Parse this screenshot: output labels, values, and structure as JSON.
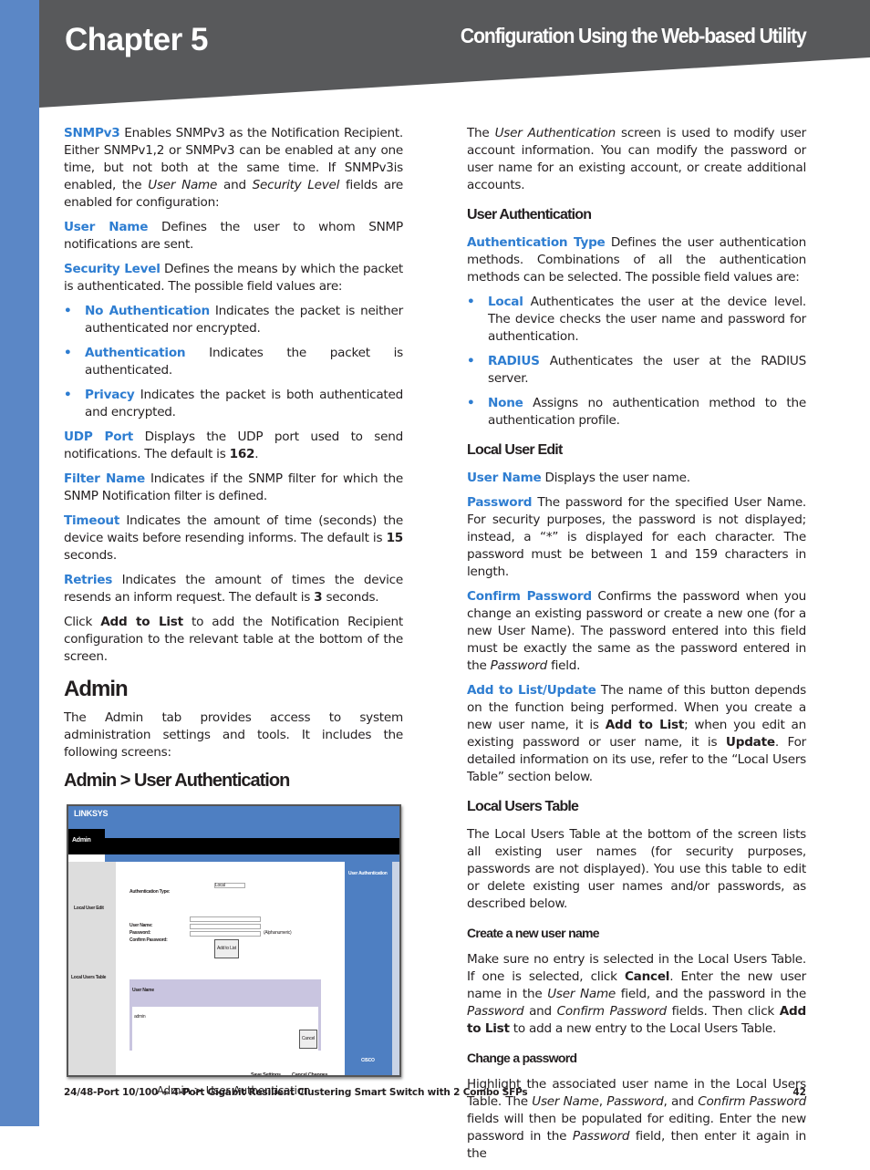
{
  "header": {
    "chapter": "Chapter 5",
    "title": "Configuration Using the Web-based Utility"
  },
  "colors": {
    "accent": "#2e7dd1",
    "band": "#58595b",
    "strip": "#5b87c6"
  },
  "left": [
    {
      "type": "p",
      "segs": [
        [
          "t",
          "SNMPv3"
        ],
        [
          "n",
          "  Enables SNMPv3 as the Notification Recipient. Either SNMPv1,2 or SNMPv3 can be enabled at any one time, but not both at the same time. If SNMPv3is enabled, the "
        ],
        [
          "i",
          "User Name"
        ],
        [
          "n",
          " and "
        ],
        [
          "i",
          "Security Level"
        ],
        [
          "n",
          " fields are enabled for configuration:"
        ]
      ]
    },
    {
      "type": "p",
      "segs": [
        [
          "t",
          "User Name"
        ],
        [
          "n",
          "  Defines the user to whom SNMP notifications are sent."
        ]
      ]
    },
    {
      "type": "p",
      "segs": [
        [
          "t",
          "Security Level"
        ],
        [
          "n",
          "  Defines the means by which the packet is authenticated. The possible field values are:"
        ]
      ]
    },
    {
      "type": "bullet",
      "segs": [
        [
          "t",
          "No Authentication"
        ],
        [
          "n",
          "  Indicates the packet is neither authenticated nor encrypted."
        ]
      ]
    },
    {
      "type": "bullet",
      "segs": [
        [
          "t",
          "Authentication"
        ],
        [
          "n",
          "  Indicates the packet is authenticated."
        ]
      ]
    },
    {
      "type": "bullet",
      "segs": [
        [
          "t",
          "Privacy"
        ],
        [
          "n",
          "  Indicates the packet is both authenticated and encrypted."
        ]
      ]
    },
    {
      "type": "p",
      "segs": [
        [
          "t",
          "UDP Port"
        ],
        [
          "n",
          "  Displays the UDP port used to send notifications. The default is "
        ],
        [
          "b",
          "162"
        ],
        [
          "n",
          "."
        ]
      ]
    },
    {
      "type": "p",
      "segs": [
        [
          "t",
          "Filter Name"
        ],
        [
          "n",
          "  Indicates if the SNMP filter for which the SNMP Notification filter is defined."
        ]
      ]
    },
    {
      "type": "p",
      "segs": [
        [
          "t",
          "Timeout"
        ],
        [
          "n",
          "  Indicates the amount of time (seconds) the device waits before resending informs. The default is "
        ],
        [
          "b",
          "15"
        ],
        [
          "n",
          " seconds."
        ]
      ]
    },
    {
      "type": "p",
      "segs": [
        [
          "t",
          "Retries"
        ],
        [
          "n",
          "  Indicates the amount of times the device resends an inform request. The default is "
        ],
        [
          "b",
          "3"
        ],
        [
          "n",
          " seconds."
        ]
      ]
    },
    {
      "type": "p",
      "segs": [
        [
          "n",
          "Click "
        ],
        [
          "b",
          "Add to List"
        ],
        [
          "n",
          " to add the Notification Recipient configuration to the relevant table at the bottom of the screen."
        ]
      ]
    },
    {
      "type": "h2",
      "segs": [
        [
          "n",
          "Admin"
        ]
      ]
    },
    {
      "type": "p",
      "segs": [
        [
          "n",
          "The Admin tab provides access to system administration settings and tools. It includes the following screens:"
        ]
      ]
    },
    {
      "type": "h3",
      "segs": [
        [
          "n",
          "Admin > User Authentication"
        ]
      ]
    },
    {
      "type": "figure",
      "caption": "Admin > User Authentication"
    }
  ],
  "right": [
    {
      "type": "p",
      "segs": [
        [
          "n",
          "The "
        ],
        [
          "i",
          "User Authentication"
        ],
        [
          "n",
          " screen is used to modify user account information. You can modify the password or user name for an existing account, or create additional accounts."
        ]
      ]
    },
    {
      "type": "h4",
      "segs": [
        [
          "n",
          "User Authentication"
        ]
      ]
    },
    {
      "type": "p",
      "segs": [
        [
          "t",
          "Authentication Type"
        ],
        [
          "n",
          "  Defines the user authentication methods. Combinations of all the authentication methods can be selected. The possible field values are:"
        ]
      ]
    },
    {
      "type": "bullet",
      "segs": [
        [
          "t",
          "Local"
        ],
        [
          "n",
          "  Authenticates the user at the device level. The device checks the user name and password for authentication."
        ]
      ]
    },
    {
      "type": "bullet",
      "segs": [
        [
          "t",
          "RADIUS"
        ],
        [
          "n",
          "  Authenticates the user at the RADIUS server."
        ]
      ]
    },
    {
      "type": "bullet",
      "segs": [
        [
          "t",
          "None"
        ],
        [
          "n",
          "  Assigns no authentication method to the authentication profile."
        ]
      ]
    },
    {
      "type": "h4",
      "segs": [
        [
          "n",
          "Local User Edit"
        ]
      ]
    },
    {
      "type": "p",
      "segs": [
        [
          "t",
          "User Name"
        ],
        [
          "n",
          "  Displays the user name."
        ]
      ]
    },
    {
      "type": "p",
      "segs": [
        [
          "t",
          "Password"
        ],
        [
          "n",
          "  The password for the specified User Name. For security purposes, the password is not displayed; instead, a “*” is displayed for each character. The password must be between 1 and 159 characters in length."
        ]
      ]
    },
    {
      "type": "p",
      "segs": [
        [
          "t",
          "Confirm Password"
        ],
        [
          "n",
          "  Confirms the password when you change an existing password or create a new one (for a new User Name). The password entered into this field must be exactly the same as the password entered in the "
        ],
        [
          "i",
          "Password"
        ],
        [
          "n",
          " field."
        ]
      ]
    },
    {
      "type": "p",
      "segs": [
        [
          "t",
          "Add to List/Update"
        ],
        [
          "n",
          "  The name of this button depends on the function being performed. When you create a new user name, it is "
        ],
        [
          "b",
          "Add to List"
        ],
        [
          "n",
          "; when you edit an existing password or user name, it is "
        ],
        [
          "b",
          "Update"
        ],
        [
          "n",
          ". For detailed information on its use, refer to the “Local Users Table” section below."
        ]
      ]
    },
    {
      "type": "h4",
      "segs": [
        [
          "n",
          "Local Users Table"
        ]
      ]
    },
    {
      "type": "p",
      "segs": [
        [
          "n",
          "The Local Users Table at the bottom of the screen lists all existing user names (for security purposes, passwords are not displayed). You use this table to edit or delete existing user names and/or passwords, as described below."
        ]
      ]
    },
    {
      "type": "h5",
      "segs": [
        [
          "n",
          "Create a new user name"
        ]
      ]
    },
    {
      "type": "p",
      "segs": [
        [
          "n",
          "Make sure no entry is selected in the Local Users Table. If one is selected, click "
        ],
        [
          "b",
          "Cancel"
        ],
        [
          "n",
          ". Enter the new user name in the "
        ],
        [
          "i",
          "User Name"
        ],
        [
          "n",
          " field, and the password in the "
        ],
        [
          "i",
          "Password"
        ],
        [
          "n",
          " and "
        ],
        [
          "i",
          "Confirm Password"
        ],
        [
          "n",
          " fields. Then click "
        ],
        [
          "b",
          "Add to List"
        ],
        [
          "n",
          " to add a new entry to the Local Users Table."
        ]
      ]
    },
    {
      "type": "h5",
      "segs": [
        [
          "n",
          "Change a password"
        ]
      ]
    },
    {
      "type": "p",
      "segs": [
        [
          "n",
          "Highlight the associated user name in the Local Users Table. The "
        ],
        [
          "i",
          "User Name"
        ],
        [
          "n",
          ", "
        ],
        [
          "i",
          "Password"
        ],
        [
          "n",
          ", and "
        ],
        [
          "i",
          "Confirm Password"
        ],
        [
          "n",
          " fields will then be populated for editing. Enter the new password in the "
        ],
        [
          "i",
          "Password"
        ],
        [
          "n",
          " field, then enter it again in the"
        ]
      ]
    }
  ],
  "figure": {
    "logo": "LINKSYS",
    "section": "Admin",
    "auth_type_label": "Authentication Type:",
    "auth_type_value": "Local",
    "local_user_edit": "Local User Edit",
    "user_name_label": "User Name:",
    "password_label": "Password:",
    "confirm_label": "Confirm Password:",
    "alnum": "(Alphanumeric)",
    "add_button": "Add to List",
    "local_users_table": "Local Users Table",
    "table_header": "User Name",
    "table_row": "admin",
    "cancel": "Cancel",
    "save": "Save Settings",
    "cancel_changes": "Cancel Changes",
    "help_title": "User Authentication",
    "cisco": "CISCO"
  },
  "footer": {
    "text": "24/48-Port 10/100 + 4-Port Gigabit Resilient Clustering Smart Switch with 2 Combo SFPs",
    "page": "42"
  }
}
